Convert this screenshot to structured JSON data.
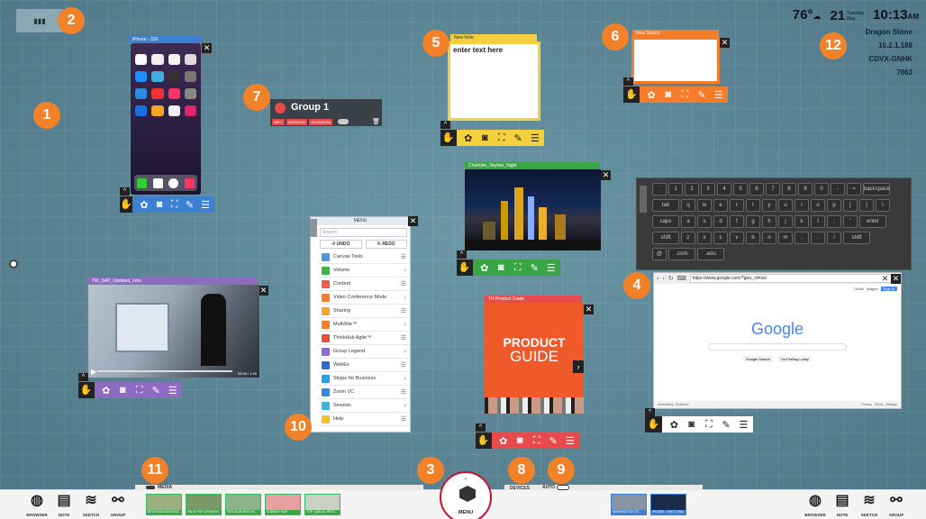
{
  "status_bar": {
    "temperature": "76°",
    "day": "21",
    "weekday": "Tuesday",
    "month": "May",
    "time": "10:13",
    "ampm": "AM",
    "room_name": "Dragon Stone",
    "ip_address": "10.2.1.188",
    "device_code": "CDVX-GNHK",
    "pin": "7063"
  },
  "callouts": [
    "1",
    "2",
    "3",
    "4",
    "5",
    "6",
    "7",
    "8",
    "9",
    "10",
    "11",
    "12"
  ],
  "phone_window": {
    "title": "iPhone - 330"
  },
  "group": {
    "name": "Group 1",
    "buttons": [
      "INFO",
      "ARRANGE",
      "ADVANCED"
    ]
  },
  "note": {
    "title": "New Note",
    "placeholder": "enter text here"
  },
  "sketch": {
    "title": "New Sketch"
  },
  "image_window": {
    "title": "Charlotte_Skyline_Night"
  },
  "video_window": {
    "title": "TW_SAP_Updated_Intro",
    "time": "00:06 / 1:45"
  },
  "product_guide": {
    "title": "TH Product Guide",
    "line1": "PRODUCT",
    "line2": "GUIDE"
  },
  "menu": {
    "title": "MENU",
    "search_placeholder": "Search",
    "undo": "UNDO",
    "redo": "REDO",
    "items": [
      {
        "label": "Canvas Tools",
        "color": "#4a9be0"
      },
      {
        "label": "Volume",
        "color": "#3bb54a"
      },
      {
        "label": "Content",
        "color": "#f05a4a"
      },
      {
        "label": "Video Conference Mode",
        "color": "#f57c2a"
      },
      {
        "label": "Sharing",
        "color": "#f5a623"
      },
      {
        "label": "MultiSite™",
        "color": "#f57c2a"
      },
      {
        "label": "ThinkHub Agile™",
        "color": "#e94e3c"
      },
      {
        "label": "Group Legend",
        "color": "#8e6bd0"
      },
      {
        "label": "WebEx",
        "color": "#2d6bd6"
      },
      {
        "label": "Skype for Business",
        "color": "#2aa0e0"
      },
      {
        "label": "Zoom VC",
        "color": "#2d8ce0"
      },
      {
        "label": "Session",
        "color": "#3bb5e0"
      },
      {
        "label": "Help",
        "color": "#f5c023"
      }
    ]
  },
  "keyboard": {
    "row1": [
      "`",
      "1",
      "2",
      "3",
      "4",
      "5",
      "6",
      "7",
      "8",
      "9",
      "0",
      "-",
      "=",
      "backspace"
    ],
    "row2": [
      "tab",
      "q",
      "w",
      "e",
      "r",
      "t",
      "y",
      "u",
      "i",
      "o",
      "p",
      "[",
      "]",
      "\\"
    ],
    "row3": [
      "caps",
      "a",
      "s",
      "d",
      "f",
      "g",
      "h",
      "j",
      "k",
      "l",
      ";",
      "'",
      "enter"
    ],
    "row4": [
      "shift",
      "z",
      "x",
      "c",
      "v",
      "b",
      "n",
      "m",
      ",",
      ".",
      "/",
      "shift"
    ],
    "row5": [
      "@",
      ".com",
      ".edu"
    ]
  },
  "browser": {
    "url": "https://www.google.com/?gws_rd=ssl",
    "logo": "Google",
    "search_button": "Google Search",
    "lucky_button": "I'm Feeling Lucky",
    "top_links": [
      "Gmail",
      "Images"
    ],
    "sign_in": "Sign in",
    "footer_left": [
      "Advertising",
      "Business"
    ],
    "footer_right": [
      "Privacy",
      "Terms",
      "Settings"
    ]
  },
  "dock": {
    "left_buttons": [
      "BROWSER",
      "NOTE",
      "SKETCH",
      "GROUP"
    ],
    "right_buttons": [
      "BROWSER",
      "NOTE",
      "SKETCH",
      "GROUP"
    ],
    "media_label": "MEDIA",
    "menu_label": "MENU",
    "devices_label": "DEVICES",
    "auto_label": "AUTO",
    "media_thumbs": [
      "BEDROOM DESIGNS",
      "PALM POP GROWTH",
      "RESTAURANTS IN...",
      "SUBWAY MAP",
      "TOP CASUAL REST..."
    ],
    "device_thumbs": [
      "WASHINGTON DC",
      "IPHONE - SHOT_B52"
    ]
  },
  "colors": {
    "blue": "#3d7fd1",
    "yellow": "#f4d03f",
    "orange": "#f57c2a",
    "green": "#3aa544",
    "purple": "#8d6bbf",
    "red": "#e64a4a",
    "callout": "#f2822a"
  },
  "toolbar_icons": [
    "hand-icon",
    "palette-icon",
    "camera-icon",
    "fullscreen-icon",
    "pin-icon",
    "list-icon"
  ]
}
